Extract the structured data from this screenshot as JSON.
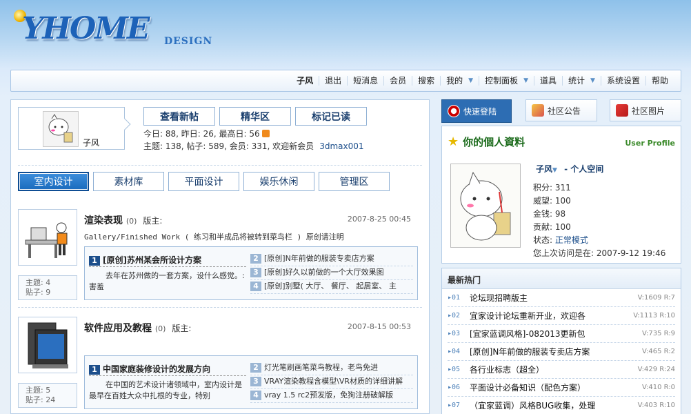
{
  "logo": {
    "big": "YHOME",
    "small": "DESIGN"
  },
  "nav": {
    "items": [
      {
        "label": "子风",
        "arrow": false
      },
      {
        "label": "退出",
        "arrow": false
      },
      {
        "label": "短消息",
        "arrow": false
      },
      {
        "label": "会员",
        "arrow": false
      },
      {
        "label": "搜索",
        "arrow": false
      },
      {
        "label": "我的",
        "arrow": true
      },
      {
        "label": "控制面板",
        "arrow": true
      },
      {
        "label": "道具",
        "arrow": false
      },
      {
        "label": "统计",
        "arrow": true
      },
      {
        "label": "系统设置",
        "arrow": false
      },
      {
        "label": "帮助",
        "arrow": false
      }
    ],
    "arrow_glyph": "▼"
  },
  "user": {
    "name": "子风"
  },
  "actions": {
    "new_posts": "查看新帖",
    "digest": "精华区",
    "mark_read": "标记已读"
  },
  "stats": {
    "line1": "今日: 88, 昨日: 26, 最高日: 56",
    "line2": "主题: 138, 帖子: 589, 会员: 331, 欢迎新会员",
    "new_member": "3dmax001"
  },
  "tabs": [
    "室内设计",
    "素材库",
    "平面设计",
    "娱乐休闲",
    "管理区"
  ],
  "forums": [
    {
      "title": "渲染表现",
      "count": "(0)",
      "moderator": "版主:",
      "date": "2007-8-25 00:45",
      "desc": "Gallery/Finished Work ( 练习和半成品将被转到菜鸟栏 ) 原创请注明",
      "topics": "主题: 4",
      "posts": "贴子: 9",
      "lead_num": "1",
      "lead_title": "[原创]苏州某会所设计方案",
      "lead_text": "去年在苏州做的一套方案，设什么感觉。:害羞",
      "items": [
        {
          "num": "2",
          "title": "[原创]N年前做的服装专卖店方案"
        },
        {
          "num": "3",
          "title": "[原创]好久以前做的一个大厅效果图"
        },
        {
          "num": "4",
          "title": "[原创]别墅( 大厅、 餐厅、 起居室、 主"
        }
      ]
    },
    {
      "title": "软件应用及教程",
      "count": "(0)",
      "moderator": "版主:",
      "date": "2007-8-15 00:53",
      "desc": "",
      "topics": "主题: 5",
      "posts": "贴子: 24",
      "lead_num": "1",
      "lead_title": "中国家庭装修设计的发展方向",
      "lead_text": "在中国的艺术设计诸领域中，室内设计是最早在百姓大众中扎根的专业，特别",
      "items": [
        {
          "num": "2",
          "title": "灯光笔刷画笔菜鸟教程，老鸟免进"
        },
        {
          "num": "3",
          "title": "VRAY渲染教程含模型\\VR材质的详细讲解"
        },
        {
          "num": "4",
          "title": "vray 1.5 rc2预发版，免狗注册破解版"
        }
      ]
    }
  ],
  "side_tabs": [
    "快速登陆",
    "社区公告",
    "社区图片"
  ],
  "profile": {
    "title": "你的個人資料",
    "en": "User Profile",
    "name": "子风",
    "space": "- 个人空间",
    "lines": [
      "积分: 311",
      "威望: 100",
      "金钱: 98",
      "贡献: 100"
    ],
    "status_label": "状态:",
    "status_value": "正常模式",
    "last_visit": "您上次访问是在: 2007-9-12 19:46"
  },
  "hot": {
    "title": "最新热门",
    "items": [
      {
        "num": "01",
        "title": "论坛现招聘版主",
        "stat": "V:1609 R:7"
      },
      {
        "num": "02",
        "title": "宜家设计论坛重新开业，欢迎各",
        "stat": "V:1113 R:10"
      },
      {
        "num": "03",
        "title": "[宜家蓝调风格]-082013更新包",
        "stat": "V:735 R:9"
      },
      {
        "num": "04",
        "title": "[原创]N年前做的服装专卖店方案",
        "stat": "V:465 R:2"
      },
      {
        "num": "05",
        "title": "各行业标志（超全）",
        "stat": "V:429 R:24"
      },
      {
        "num": "06",
        "title": "平面设计必备知识（配色方案）",
        "stat": "V:410 R:0"
      },
      {
        "num": "07",
        "title": "（宜家蓝调）风格BUG收集，处理",
        "stat": "V:403 R:10"
      }
    ]
  }
}
